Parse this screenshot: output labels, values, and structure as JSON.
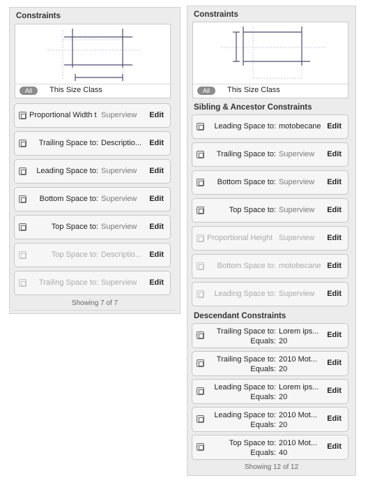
{
  "left_panel": {
    "title": "Constraints",
    "size_class": {
      "pill": "All",
      "label": "This Size Class"
    },
    "rows": [
      {
        "label": "Proportional Width t",
        "target": "Superview",
        "edit": "Edit",
        "disabled": false
      },
      {
        "label": "Trailing Space to:",
        "target": "Descriptio...",
        "edit": "Edit",
        "disabled": false,
        "dark": true
      },
      {
        "label": "Leading Space to:",
        "target": "Superview",
        "edit": "Edit",
        "disabled": false
      },
      {
        "label": "Bottom Space to:",
        "target": "Superview",
        "edit": "Edit",
        "disabled": false
      },
      {
        "label": "Top Space to:",
        "target": "Superview",
        "edit": "Edit",
        "disabled": false
      },
      {
        "label": "Top Space to:",
        "target": "Descriptio...",
        "edit": "Edit",
        "disabled": true
      },
      {
        "label": "Trailing Space to:",
        "target": "Superview",
        "edit": "Edit",
        "disabled": true
      }
    ],
    "footer": "Showing 7 of 7"
  },
  "right_panel": {
    "title": "Constraints",
    "size_class": {
      "pill": "All",
      "label": "This Size Class"
    },
    "sibling_title": "Sibling & Ancestor Constraints",
    "sibling_rows": [
      {
        "label": "Leading Space to:",
        "target": "motobecane",
        "edit": "Edit",
        "disabled": false,
        "dark": true
      },
      {
        "label": "Trailing Space to:",
        "target": "Superview",
        "edit": "Edit",
        "disabled": false
      },
      {
        "label": "Bottom Space to:",
        "target": "Superview",
        "edit": "Edit",
        "disabled": false
      },
      {
        "label": "Top Space to:",
        "target": "Superview",
        "edit": "Edit",
        "disabled": false
      },
      {
        "label": "Proportional Height",
        "target": "Superview",
        "edit": "Edit",
        "disabled": true
      },
      {
        "label": "Bottom Space to:",
        "target": "motobecane",
        "edit": "Edit",
        "disabled": true
      },
      {
        "label": "Leading Space to:",
        "target": "Superview",
        "edit": "Edit",
        "disabled": true
      }
    ],
    "descendant_title": "Descendant Constraints",
    "descendant_rows": [
      {
        "label": "Trailing Space to:",
        "target": "Lorem ips...",
        "equals_label": "Equals:",
        "equals": "20",
        "edit": "Edit"
      },
      {
        "label": "Trailing Space to:",
        "target": "2010 Mot...",
        "equals_label": "Equals:",
        "equals": "20",
        "edit": "Edit"
      },
      {
        "label": "Leading Space to:",
        "target": "Lorem ips...",
        "equals_label": "Equals:",
        "equals": "20",
        "edit": "Edit"
      },
      {
        "label": "Leading Space to:",
        "target": "2010 Mot...",
        "equals_label": "Equals:",
        "equals": "20",
        "edit": "Edit"
      },
      {
        "label": "Top Space to:",
        "target": "2010 Mot...",
        "equals_label": "Equals:",
        "equals": "40",
        "edit": "Edit"
      }
    ],
    "footer": "Showing 12 of 12"
  },
  "colors": {
    "panel_bg": "#ececec",
    "row_bg": "#f6f6f6",
    "constraint_line": "#4a4a72",
    "muted_text": "#7a7a7a"
  },
  "icons": {
    "row": "constraint-icon",
    "preview": "constraint-preview-icon"
  }
}
